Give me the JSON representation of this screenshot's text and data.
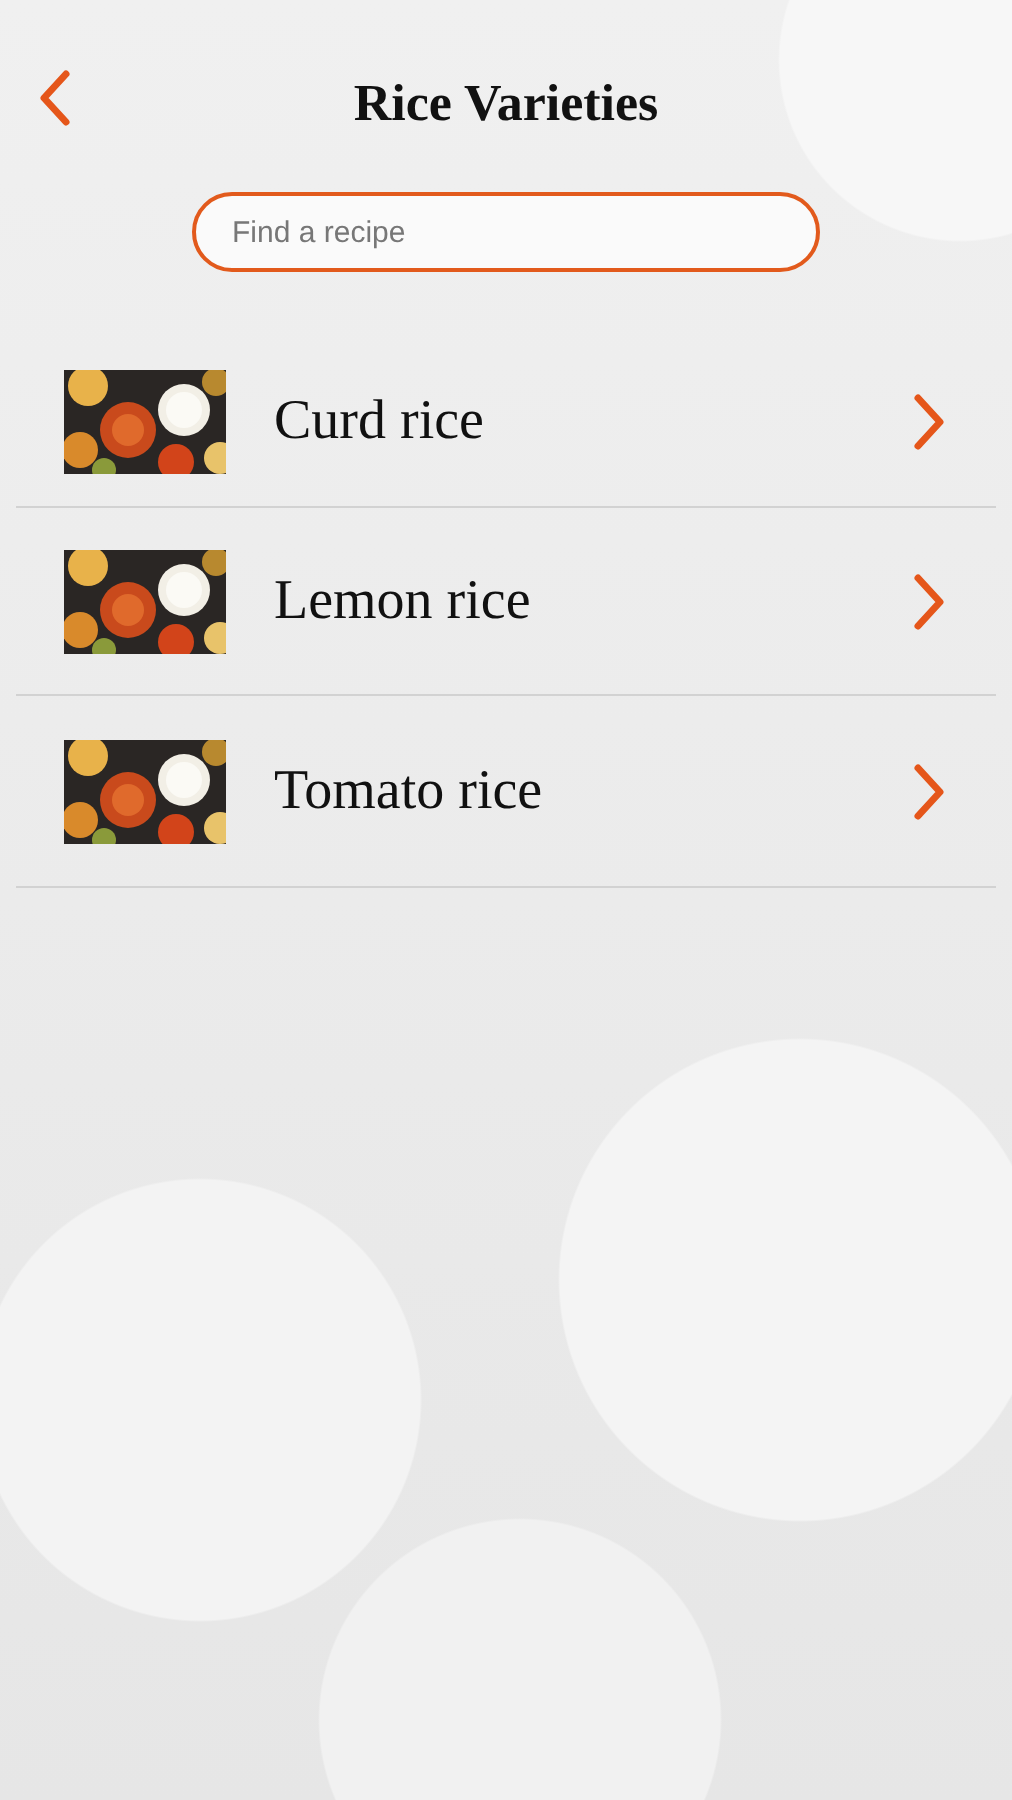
{
  "header": {
    "title": "Rice Varieties"
  },
  "search": {
    "placeholder": "Find a recipe"
  },
  "recipes": [
    {
      "name": "Curd rice",
      "kind": "picture"
    },
    {
      "name": "Lemon rice",
      "kind": "picture"
    },
    {
      "name": "Tomato rice",
      "kind": "picture"
    }
  ]
}
